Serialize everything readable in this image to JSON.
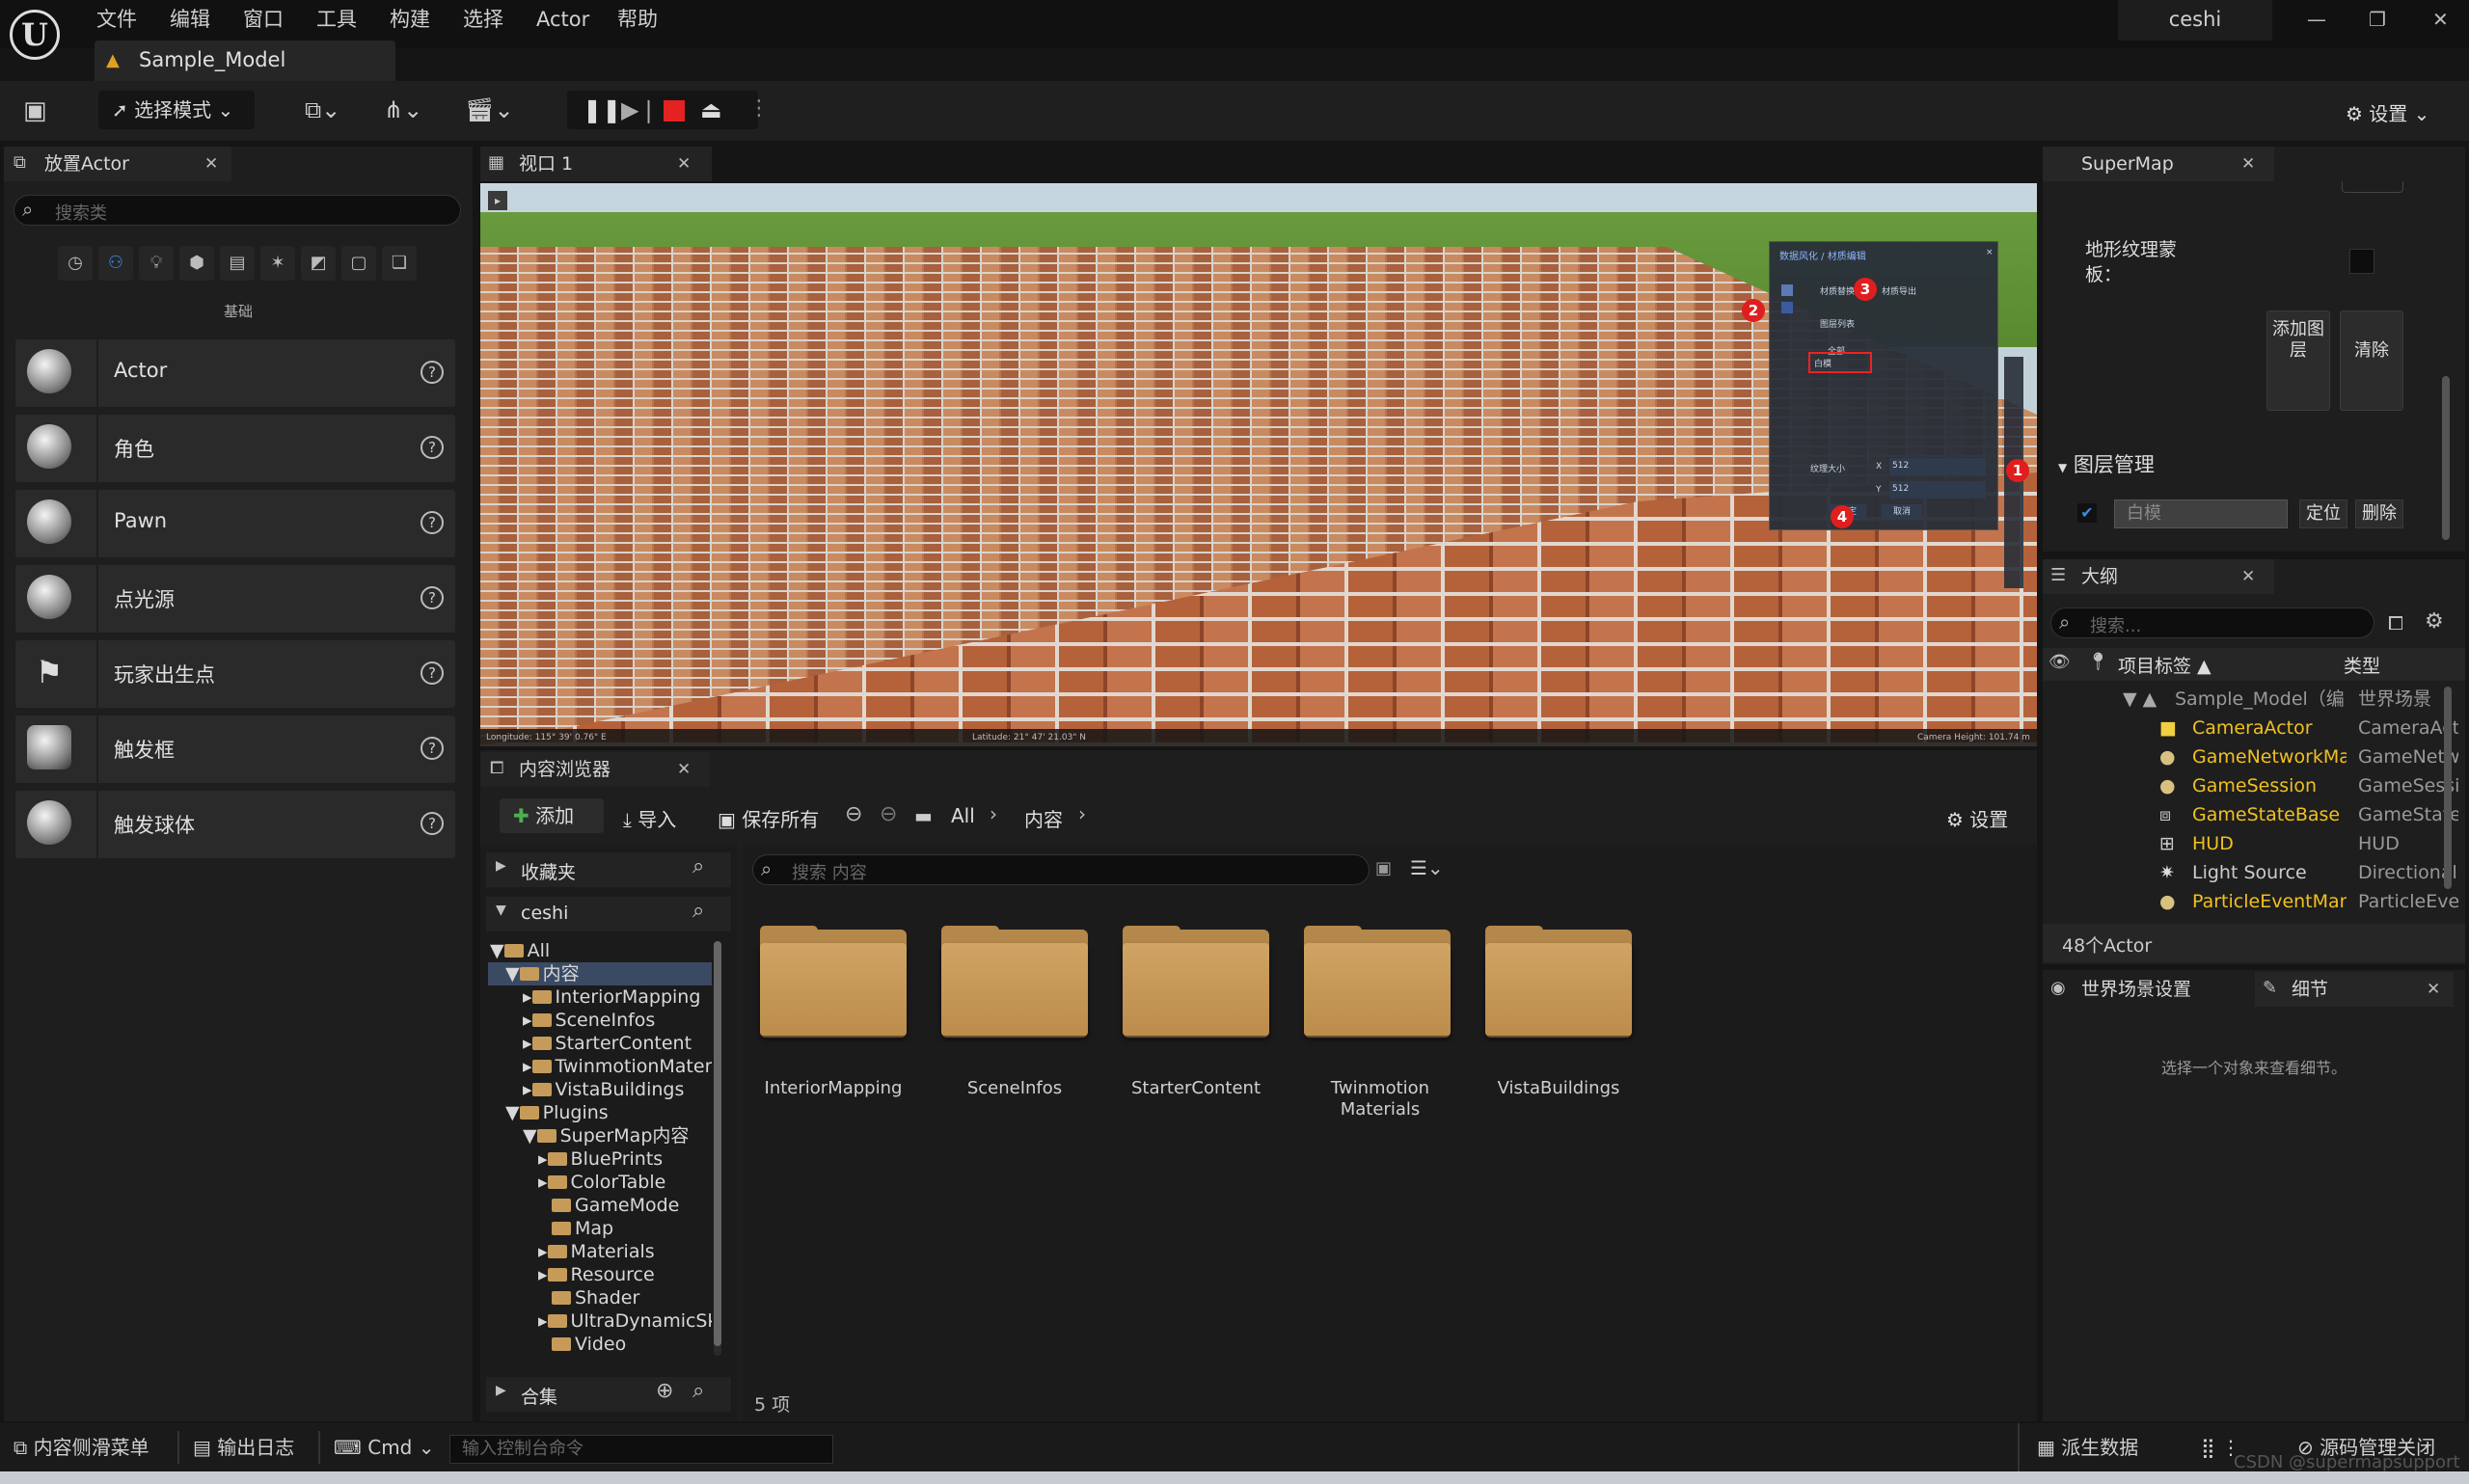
{
  "menu": [
    "文件",
    "编辑",
    "窗口",
    "工具",
    "构建",
    "选择",
    "Actor",
    "帮助"
  ],
  "doc_tab": "Sample_Model",
  "user": "ceshi",
  "toolbar": {
    "mode": "选择模式",
    "settings": "设置"
  },
  "place_actor": {
    "tab": "放置Actor",
    "search_placeholder": "搜索类",
    "section": "基础",
    "items": [
      "Actor",
      "角色",
      "Pawn",
      "点光源",
      "玩家出生点",
      "触发框",
      "触发球体"
    ]
  },
  "viewport": {
    "tab": "视口 1",
    "status_left": "Longitude: 115° 39' 0.76\" E",
    "status_mid": "Latitude: 21° 47' 21.03\" N",
    "status_right": "Camera Height: 101.74 m",
    "dialog": {
      "title": "数据风化 / 材质编辑",
      "tab1": "材质替换",
      "tab2": "材质导出",
      "list": "图层列表",
      "all": "全部",
      "item": "白模",
      "tex": "纹理大小",
      "x": "X",
      "xval": "512",
      "y": "Y",
      "yval": "512",
      "ok": "确定",
      "cancel": "取消"
    },
    "badges": [
      "1",
      "2",
      "3",
      "4"
    ]
  },
  "content_browser": {
    "tab": "内容浏览器",
    "add": "添加",
    "import": "导入",
    "save_all": "保存所有",
    "path": [
      "All",
      "内容"
    ],
    "settings": "设置",
    "favorites": "收藏夹",
    "project": "ceshi",
    "search_placeholder": "搜索 内容",
    "collections": "合集",
    "count": "5 项",
    "tree": [
      {
        "label": "All",
        "depth": 0
      },
      {
        "label": "内容",
        "depth": 1,
        "selected": true
      },
      {
        "label": "InteriorMapping",
        "depth": 2
      },
      {
        "label": "SceneInfos",
        "depth": 2
      },
      {
        "label": "StarterContent",
        "depth": 2
      },
      {
        "label": "TwinmotionMaterials",
        "depth": 2
      },
      {
        "label": "VistaBuildings",
        "depth": 2
      },
      {
        "label": "Plugins",
        "depth": 1
      },
      {
        "label": "SuperMap内容",
        "depth": 2
      },
      {
        "label": "BluePrints",
        "depth": 3
      },
      {
        "label": "ColorTable",
        "depth": 3
      },
      {
        "label": "GameMode",
        "depth": 3
      },
      {
        "label": "Map",
        "depth": 3
      },
      {
        "label": "Materials",
        "depth": 3
      },
      {
        "label": "Resource",
        "depth": 3
      },
      {
        "label": "Shader",
        "depth": 3
      },
      {
        "label": "UltraDynamicSky",
        "depth": 3
      },
      {
        "label": "Video",
        "depth": 3
      }
    ],
    "folders": [
      "InteriorMapping",
      "SceneInfos",
      "StarterContent",
      "Twinmotion Materials",
      "VistaBuildings"
    ]
  },
  "supermap": {
    "tab": "SuperMap",
    "terrain_mask": "地形纹理蒙板：",
    "add_layer": "添加图层",
    "clear": "清除",
    "layer_mgmt": "图层管理",
    "layer_name": "白模",
    "locate": "定位",
    "delete": "删除"
  },
  "outliner": {
    "tab": "大纲",
    "search_placeholder": "搜索...",
    "col_label": "项目标签",
    "col_type": "类型",
    "count": "48个Actor",
    "rows": [
      {
        "label": "Sample_Model（编",
        "type": "世界场景",
        "root": true
      },
      {
        "label": "CameraActor",
        "type": "CameraActor"
      },
      {
        "label": "GameNetworkManager",
        "type": "GameNetworkManager"
      },
      {
        "label": "GameSession",
        "type": "GameSession"
      },
      {
        "label": "GameStateBase",
        "type": "GameStateBase"
      },
      {
        "label": "HUD",
        "type": "HUD"
      },
      {
        "label": "Light Source",
        "type": "DirectionalLight"
      },
      {
        "label": "ParticleEventManager",
        "type": "ParticleEventManager"
      }
    ]
  },
  "details": {
    "tab_world": "世界场景设置",
    "tab_details": "细节",
    "empty": "选择一个对象来查看细节。"
  },
  "statusbar": {
    "drawer": "内容侧滑菜单",
    "log": "输出日志",
    "cmd": "Cmd",
    "console_placeholder": "输入控制台命令",
    "derived": "派生数据",
    "source": "源码管理关闭"
  },
  "watermark": "CSDN @supermapsupport"
}
